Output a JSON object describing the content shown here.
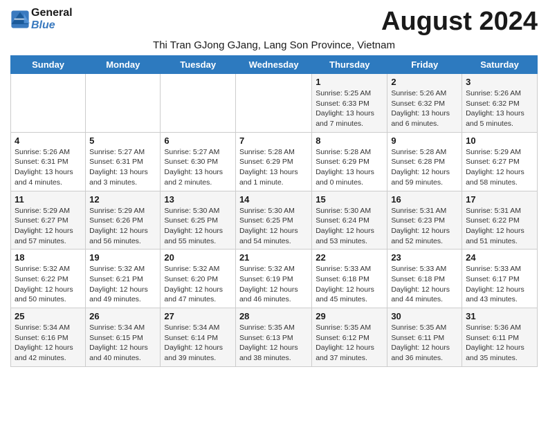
{
  "header": {
    "logo_general": "General",
    "logo_blue": "Blue",
    "month_title": "August 2024",
    "subtitle": "Thi Tran GJong GJang, Lang Son Province, Vietnam"
  },
  "weekdays": [
    "Sunday",
    "Monday",
    "Tuesday",
    "Wednesday",
    "Thursday",
    "Friday",
    "Saturday"
  ],
  "weeks": [
    [
      {
        "day": "",
        "info": ""
      },
      {
        "day": "",
        "info": ""
      },
      {
        "day": "",
        "info": ""
      },
      {
        "day": "",
        "info": ""
      },
      {
        "day": "1",
        "info": "Sunrise: 5:25 AM\nSunset: 6:33 PM\nDaylight: 13 hours\nand 7 minutes."
      },
      {
        "day": "2",
        "info": "Sunrise: 5:26 AM\nSunset: 6:32 PM\nDaylight: 13 hours\nand 6 minutes."
      },
      {
        "day": "3",
        "info": "Sunrise: 5:26 AM\nSunset: 6:32 PM\nDaylight: 13 hours\nand 5 minutes."
      }
    ],
    [
      {
        "day": "4",
        "info": "Sunrise: 5:26 AM\nSunset: 6:31 PM\nDaylight: 13 hours\nand 4 minutes."
      },
      {
        "day": "5",
        "info": "Sunrise: 5:27 AM\nSunset: 6:31 PM\nDaylight: 13 hours\nand 3 minutes."
      },
      {
        "day": "6",
        "info": "Sunrise: 5:27 AM\nSunset: 6:30 PM\nDaylight: 13 hours\nand 2 minutes."
      },
      {
        "day": "7",
        "info": "Sunrise: 5:28 AM\nSunset: 6:29 PM\nDaylight: 13 hours\nand 1 minute."
      },
      {
        "day": "8",
        "info": "Sunrise: 5:28 AM\nSunset: 6:29 PM\nDaylight: 13 hours\nand 0 minutes."
      },
      {
        "day": "9",
        "info": "Sunrise: 5:28 AM\nSunset: 6:28 PM\nDaylight: 12 hours\nand 59 minutes."
      },
      {
        "day": "10",
        "info": "Sunrise: 5:29 AM\nSunset: 6:27 PM\nDaylight: 12 hours\nand 58 minutes."
      }
    ],
    [
      {
        "day": "11",
        "info": "Sunrise: 5:29 AM\nSunset: 6:27 PM\nDaylight: 12 hours\nand 57 minutes."
      },
      {
        "day": "12",
        "info": "Sunrise: 5:29 AM\nSunset: 6:26 PM\nDaylight: 12 hours\nand 56 minutes."
      },
      {
        "day": "13",
        "info": "Sunrise: 5:30 AM\nSunset: 6:25 PM\nDaylight: 12 hours\nand 55 minutes."
      },
      {
        "day": "14",
        "info": "Sunrise: 5:30 AM\nSunset: 6:25 PM\nDaylight: 12 hours\nand 54 minutes."
      },
      {
        "day": "15",
        "info": "Sunrise: 5:30 AM\nSunset: 6:24 PM\nDaylight: 12 hours\nand 53 minutes."
      },
      {
        "day": "16",
        "info": "Sunrise: 5:31 AM\nSunset: 6:23 PM\nDaylight: 12 hours\nand 52 minutes."
      },
      {
        "day": "17",
        "info": "Sunrise: 5:31 AM\nSunset: 6:22 PM\nDaylight: 12 hours\nand 51 minutes."
      }
    ],
    [
      {
        "day": "18",
        "info": "Sunrise: 5:32 AM\nSunset: 6:22 PM\nDaylight: 12 hours\nand 50 minutes."
      },
      {
        "day": "19",
        "info": "Sunrise: 5:32 AM\nSunset: 6:21 PM\nDaylight: 12 hours\nand 49 minutes."
      },
      {
        "day": "20",
        "info": "Sunrise: 5:32 AM\nSunset: 6:20 PM\nDaylight: 12 hours\nand 47 minutes."
      },
      {
        "day": "21",
        "info": "Sunrise: 5:32 AM\nSunset: 6:19 PM\nDaylight: 12 hours\nand 46 minutes."
      },
      {
        "day": "22",
        "info": "Sunrise: 5:33 AM\nSunset: 6:18 PM\nDaylight: 12 hours\nand 45 minutes."
      },
      {
        "day": "23",
        "info": "Sunrise: 5:33 AM\nSunset: 6:18 PM\nDaylight: 12 hours\nand 44 minutes."
      },
      {
        "day": "24",
        "info": "Sunrise: 5:33 AM\nSunset: 6:17 PM\nDaylight: 12 hours\nand 43 minutes."
      }
    ],
    [
      {
        "day": "25",
        "info": "Sunrise: 5:34 AM\nSunset: 6:16 PM\nDaylight: 12 hours\nand 42 minutes."
      },
      {
        "day": "26",
        "info": "Sunrise: 5:34 AM\nSunset: 6:15 PM\nDaylight: 12 hours\nand 40 minutes."
      },
      {
        "day": "27",
        "info": "Sunrise: 5:34 AM\nSunset: 6:14 PM\nDaylight: 12 hours\nand 39 minutes."
      },
      {
        "day": "28",
        "info": "Sunrise: 5:35 AM\nSunset: 6:13 PM\nDaylight: 12 hours\nand 38 minutes."
      },
      {
        "day": "29",
        "info": "Sunrise: 5:35 AM\nSunset: 6:12 PM\nDaylight: 12 hours\nand 37 minutes."
      },
      {
        "day": "30",
        "info": "Sunrise: 5:35 AM\nSunset: 6:11 PM\nDaylight: 12 hours\nand 36 minutes."
      },
      {
        "day": "31",
        "info": "Sunrise: 5:36 AM\nSunset: 6:11 PM\nDaylight: 12 hours\nand 35 minutes."
      }
    ]
  ]
}
